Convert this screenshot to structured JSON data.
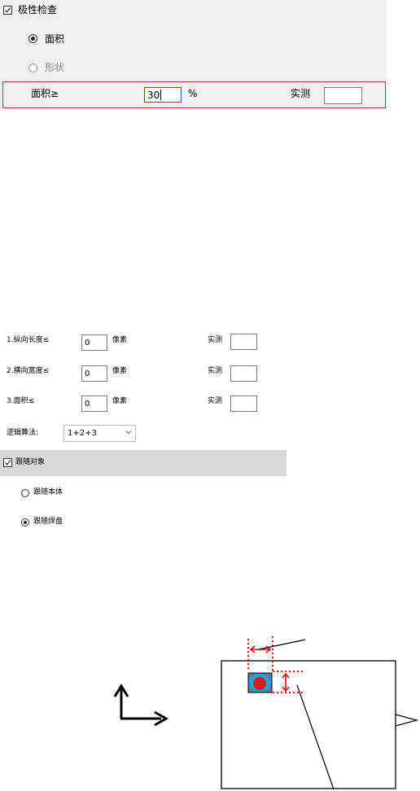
{
  "polarity": {
    "checkbox_label": "极性检查",
    "checked": true,
    "options": [
      {
        "label": "面积",
        "selected": true,
        "enabled": true
      },
      {
        "label": "形状",
        "selected": false,
        "enabled": false
      }
    ],
    "area_row": {
      "label": "面积≥",
      "value": "30",
      "unit": "%",
      "measured_label": "实测",
      "measured_value": ""
    }
  },
  "filters": [
    {
      "label": "1.纵向长度≤",
      "value": "0",
      "unit": "像素",
      "measured_label": "实测"
    },
    {
      "label": "2.横向宽度≤",
      "value": "0",
      "unit": "像素",
      "measured_label": "实测"
    },
    {
      "label": "3.面积≤",
      "value": "0",
      "unit": "像素",
      "measured_label": "实测"
    }
  ],
  "logic": {
    "label": "逻辑算法:",
    "value": "1+2+3"
  },
  "follow": {
    "checkbox_label": "跟随对象",
    "checked": true,
    "options": [
      {
        "label": "跟随本体",
        "selected": false
      },
      {
        "label": "跟随焊盘",
        "selected": true
      }
    ]
  },
  "diagram": {
    "colors": {
      "dotted": "#ff0000",
      "pad": "#1aa3e8",
      "body": "#d81b1b"
    }
  }
}
